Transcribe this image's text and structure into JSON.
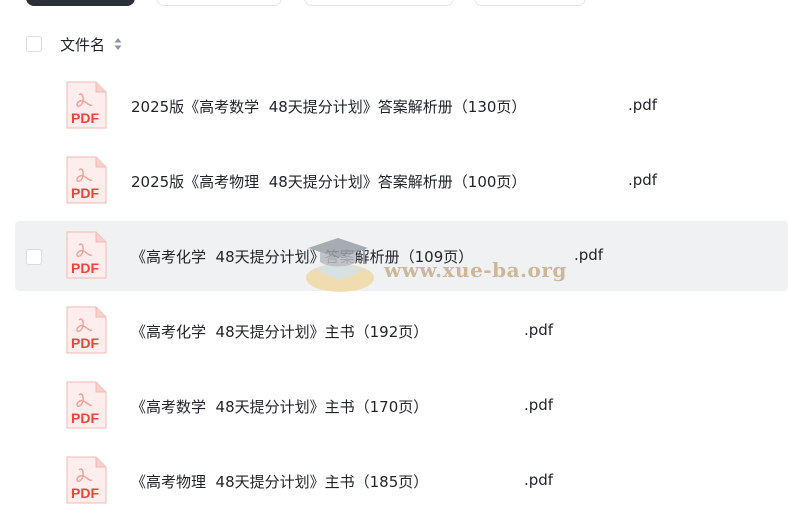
{
  "header": {
    "column_label": "文件名"
  },
  "watermark": {
    "text": "www.xue-ba.org"
  },
  "files": [
    {
      "name": "2025版《高考数学  48天提分计划》答案解析册（130页）",
      "ext": ".pdf",
      "icon": "pdf-icon",
      "icon_label": "PDF"
    },
    {
      "name": "2025版《高考物理  48天提分计划》答案解析册（100页）",
      "ext": ".pdf",
      "icon": "pdf-icon",
      "icon_label": "PDF"
    },
    {
      "name": "《高考化学  48天提分计划》答案解析册（109页）",
      "ext": ".pdf",
      "icon": "pdf-icon",
      "icon_label": "PDF"
    },
    {
      "name": "《高考化学  48天提分计划》主书（192页）",
      "ext": ".pdf",
      "icon": "pdf-icon",
      "icon_label": "PDF"
    },
    {
      "name": "《高考数学  48天提分计划》主书（170页）",
      "ext": ".pdf",
      "icon": "pdf-icon",
      "icon_label": "PDF"
    },
    {
      "name": "《高考物理  48天提分计划》主书（185页）",
      "ext": ".pdf",
      "icon": "pdf-icon",
      "icon_label": "PDF"
    }
  ],
  "colors": {
    "pdf_red": "#e8453c",
    "hover_row": "#f0f1f3"
  }
}
